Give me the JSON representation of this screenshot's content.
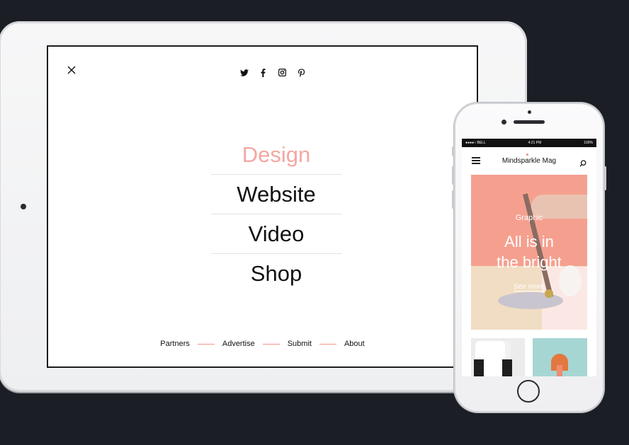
{
  "tablet": {
    "social_icons": [
      "twitter-icon",
      "facebook-icon",
      "instagram-icon",
      "pinterest-icon"
    ],
    "menu": [
      {
        "label": "Design",
        "active": true
      },
      {
        "label": "Website",
        "active": false
      },
      {
        "label": "Video",
        "active": false
      },
      {
        "label": "Shop",
        "active": false
      }
    ],
    "footer_links": [
      "Partners",
      "Advertise",
      "Submit",
      "About"
    ],
    "accent_color": "#f4a7a3",
    "divider_color": "#f0938a"
  },
  "phone": {
    "status": {
      "carrier": "●●●●○ BELL",
      "time": "4:21 PM",
      "battery": "100%"
    },
    "app_title": "Mindsparkle Mag",
    "hero": {
      "category": "Graphic",
      "title_line1": "All is in",
      "title_line2": "the bright",
      "link": "See more"
    },
    "hero_background": "#f5a08f"
  }
}
